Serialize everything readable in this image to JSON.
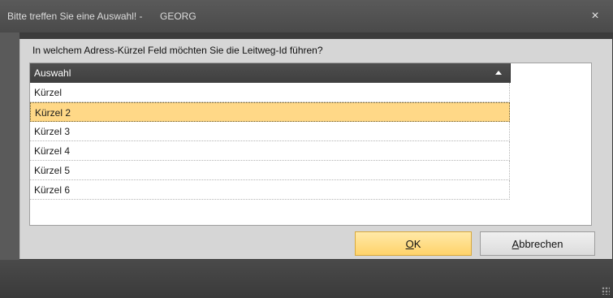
{
  "window": {
    "title": "Bitte treffen Sie eine Auswahl! -",
    "app_name": "GEORG",
    "close_glyph": "×"
  },
  "prompt": "In welchem Adress-Kürzel Feld möchten Sie die Leitweg-Id führen?",
  "grid": {
    "column_header": "Auswahl",
    "sort_icon": "sort-ascending-icon",
    "rows": [
      "Kürzel",
      "Kürzel 2",
      "Kürzel 3",
      "Kürzel 4",
      "Kürzel 5",
      "Kürzel 6"
    ],
    "selected_index": 1
  },
  "buttons": {
    "ok_mnemonic": "O",
    "ok_rest": "K",
    "cancel_mnemonic": "A",
    "cancel_rest": "bbrechen"
  },
  "colors": {
    "selection": "#ffd887",
    "ok_button": "#ffd36a",
    "header": "#4a4a4a"
  }
}
